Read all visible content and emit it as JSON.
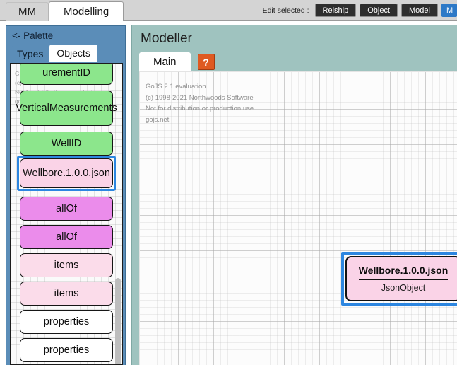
{
  "window": {
    "main_tabs": [
      {
        "label": "MM",
        "active": false
      },
      {
        "label": "Modelling",
        "active": true
      }
    ],
    "edit_toolbar": {
      "label": "Edit selected :",
      "buttons": [
        {
          "label": "Relship",
          "selected": false
        },
        {
          "label": "Object",
          "selected": false
        },
        {
          "label": "Model",
          "selected": false
        },
        {
          "label": "M",
          "selected": true
        }
      ]
    }
  },
  "palette": {
    "header": "<- Palette",
    "tabs": [
      {
        "label": "Types",
        "active": false
      },
      {
        "label": "Objects",
        "active": true
      }
    ],
    "watermark": [
      "GoJS 2.1 evaluation",
      "(c) 1998-2021 Northwoods Software",
      "Not for distribution or production use",
      "gojs.net"
    ],
    "items": [
      {
        "label": "urementID",
        "color": "green",
        "selected": false,
        "clipped": true
      },
      {
        "label": "VerticalMeasurements",
        "color": "green",
        "selected": false
      },
      {
        "label": "WellID",
        "color": "green",
        "selected": false
      },
      {
        "label": "Wellbore.1.0.0.json",
        "color": "pink",
        "selected": true
      },
      {
        "label": "allOf",
        "color": "magenta",
        "selected": false
      },
      {
        "label": "allOf",
        "color": "magenta",
        "selected": false
      },
      {
        "label": "items",
        "color": "lightpink",
        "selected": false
      },
      {
        "label": "items",
        "color": "lightpink",
        "selected": false
      },
      {
        "label": "properties",
        "color": "white",
        "selected": false
      },
      {
        "label": "properties",
        "color": "white",
        "selected": false
      }
    ]
  },
  "modeller": {
    "title": "Modeller",
    "tabs": [
      {
        "label": "Main",
        "active": true
      }
    ],
    "help_label": "?",
    "watermark": [
      "GoJS 2.1 evaluation",
      "(c) 1998-2021 Northwoods Software",
      "Not for distribution or production use",
      "gojs.net"
    ],
    "node": {
      "title": "Wellbore.1.0.0.json",
      "subtitle": "JsonObject",
      "selected": true
    }
  },
  "colors": {
    "palette_panel": "#5b8db8",
    "modeller_panel": "#9fc3bf",
    "selection": "#2d86e0",
    "help_button": "#df5a22",
    "toolbar_button": "#2e2e2e",
    "toolbar_button_selected": "#2d79c7",
    "node_pink": "#fad3e7",
    "node_green": "#8ce68c",
    "node_magenta": "#eb8ceb",
    "node_lightpink": "#fbdcea"
  }
}
